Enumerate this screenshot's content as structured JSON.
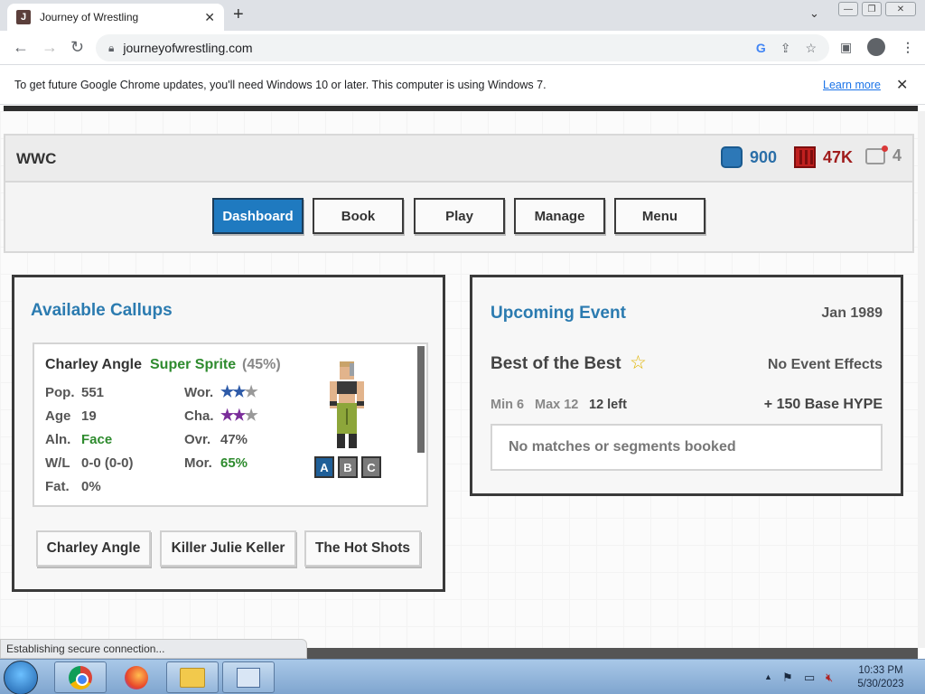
{
  "browser": {
    "tab_title": "Journey of Wrestling",
    "tab_favicon": "J",
    "tab_close": "✕",
    "new_tab": "+",
    "url": "journeyofwrestling.com"
  },
  "infobar": {
    "message": "To get future Google Chrome updates, you'll need Windows 10 or later. This computer is using Windows 7.",
    "learn_more": "Learn more",
    "close": "✕"
  },
  "header": {
    "brand": "WWC",
    "coins": "900",
    "hype": "47K",
    "messages": "4",
    "colors": {
      "coins": "#2b6fa8",
      "hype": "#a01c1c",
      "messages": "#888888"
    }
  },
  "nav": {
    "items": [
      {
        "label": "Dashboard",
        "active": true
      },
      {
        "label": "Book"
      },
      {
        "label": "Play"
      },
      {
        "label": "Manage"
      },
      {
        "label": "Menu"
      }
    ]
  },
  "callups": {
    "title": "Available Callups",
    "wrestler": {
      "name": "Charley Angle",
      "style": "Super Sprite",
      "style_pct": "(45%)",
      "pop_label": "Pop.",
      "pop": "551",
      "age_label": "Age",
      "age": "19",
      "aln_label": "Aln.",
      "aln": "Face",
      "wl_label": "W/L",
      "wl": "0-0 (0-0)",
      "fat_label": "Fat.",
      "fat": "0%",
      "wor_label": "Wor.",
      "wor_stars": 2,
      "cha_label": "Cha.",
      "cha_stars": 2,
      "ovr_label": "Ovr.",
      "ovr": "47%",
      "mor_label": "Mor.",
      "mor": "65%",
      "tags": [
        "A",
        "B",
        "C"
      ]
    },
    "roster": [
      "Charley Angle",
      "Killer Julie Keller",
      "The Hot Shots"
    ]
  },
  "event": {
    "title": "Upcoming Event",
    "date": "Jan 1989",
    "name": "Best of the Best",
    "star_icon": "☆",
    "effects": "No Event Effects",
    "min": "Min 6",
    "max": "Max 12",
    "left": "12 left",
    "hype": "+ 150 Base HYPE",
    "empty": "No matches or segments booked"
  },
  "status": {
    "message": "Establishing secure connection..."
  },
  "taskbar": {
    "time": "10:33 PM",
    "date": "5/30/2023"
  }
}
